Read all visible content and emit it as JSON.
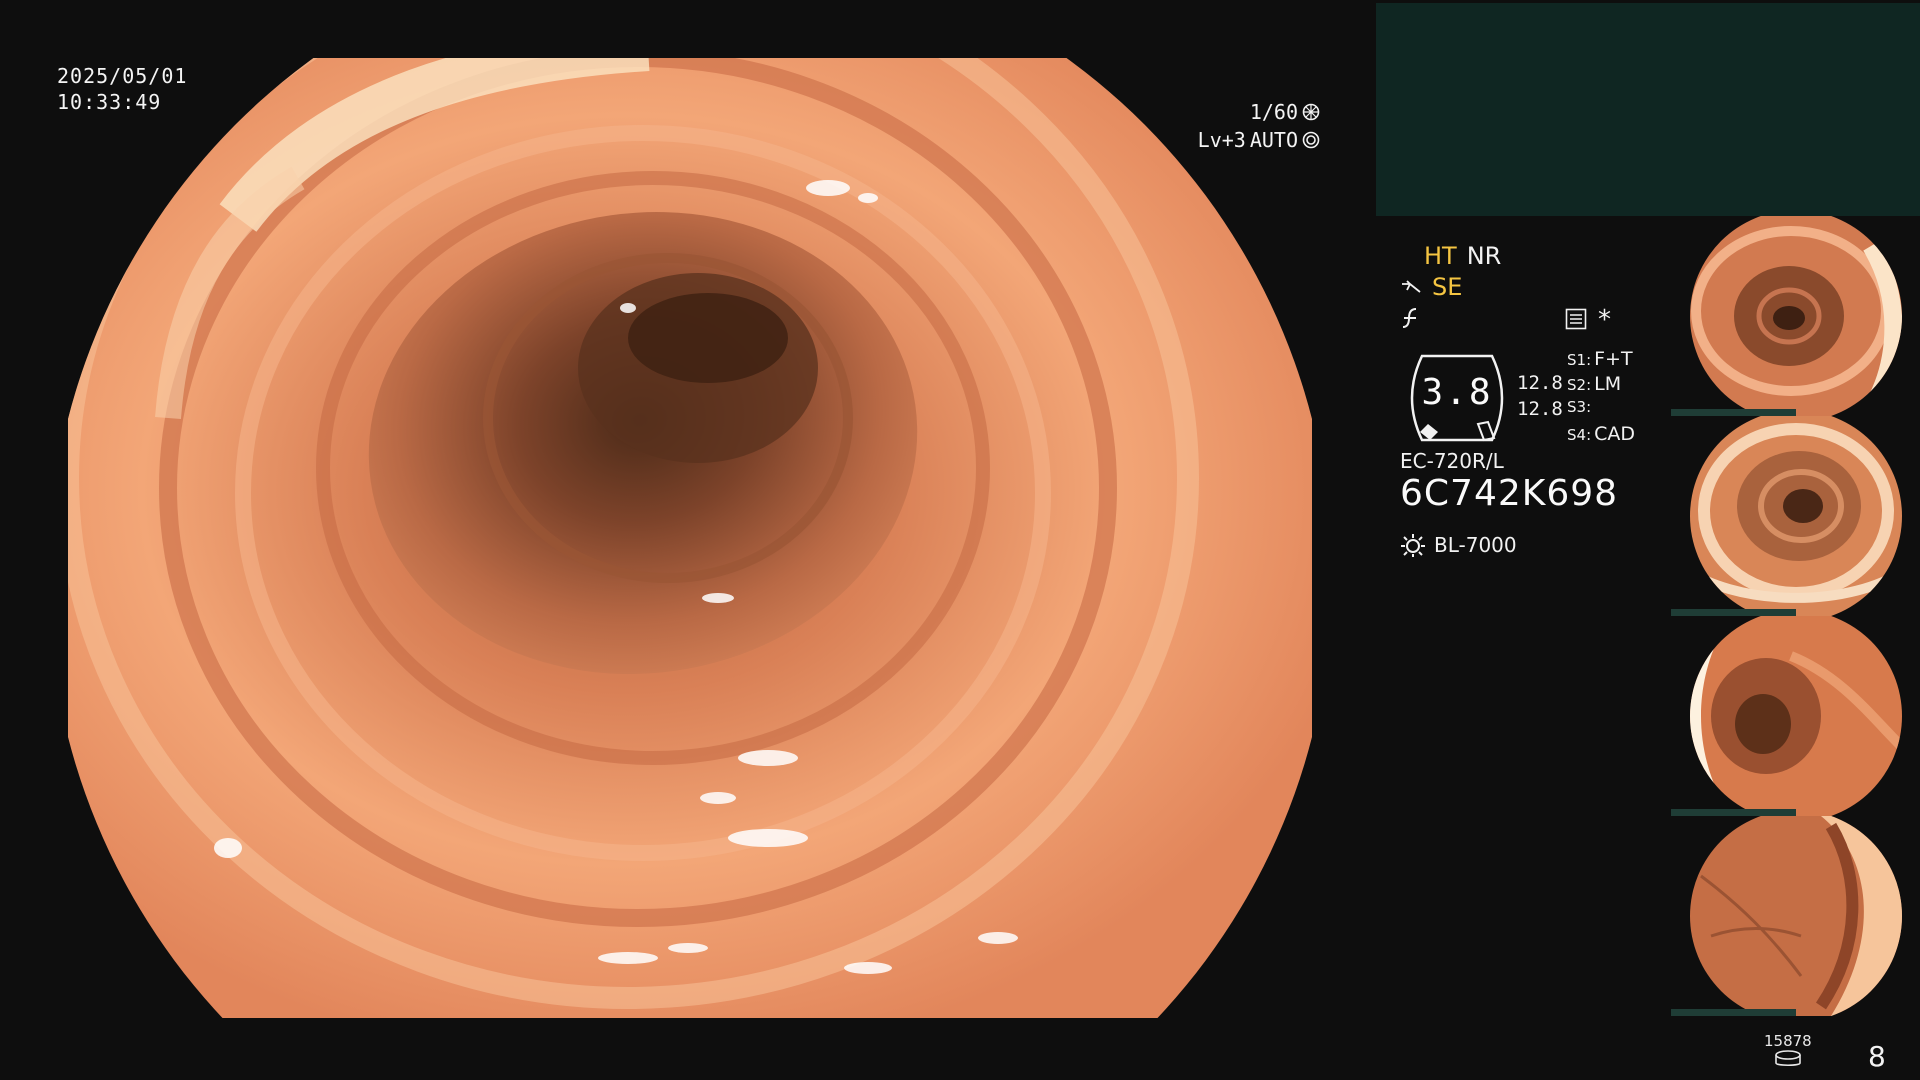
{
  "overlay": {
    "date": "2025/05/01",
    "time": "10:33:49",
    "shutter": "1/60",
    "exposure_level": "Lv+3",
    "exposure_mode": "AUTO"
  },
  "modes": {
    "ht": "HT",
    "nr": "NR",
    "se": "SE"
  },
  "settings": {
    "gauge_value": "3.8",
    "gain_top": "12.8",
    "gain_bottom": "12.8",
    "slots": [
      {
        "label": "S1:",
        "value": "F+T"
      },
      {
        "label": "S2:",
        "value": "LM"
      },
      {
        "label": "S3:",
        "value": ""
      },
      {
        "label": "S4:",
        "value": "CAD"
      }
    ],
    "asterisk": "*"
  },
  "scope": {
    "model": "EC-720R/L",
    "serial": "6C742K698",
    "light_source": "BL-7000"
  },
  "footer": {
    "storage_count": "15878",
    "page_number": "8"
  },
  "thumbnails": [
    {
      "label": "thumbnail-1"
    },
    {
      "label": "thumbnail-2"
    },
    {
      "label": "thumbnail-3"
    },
    {
      "label": "thumbnail-4"
    }
  ],
  "colors": {
    "background": "#0e0e0e",
    "preview_box": "#0f2622",
    "mode_highlight": "#f5c542",
    "tissue": "#e8855a"
  }
}
